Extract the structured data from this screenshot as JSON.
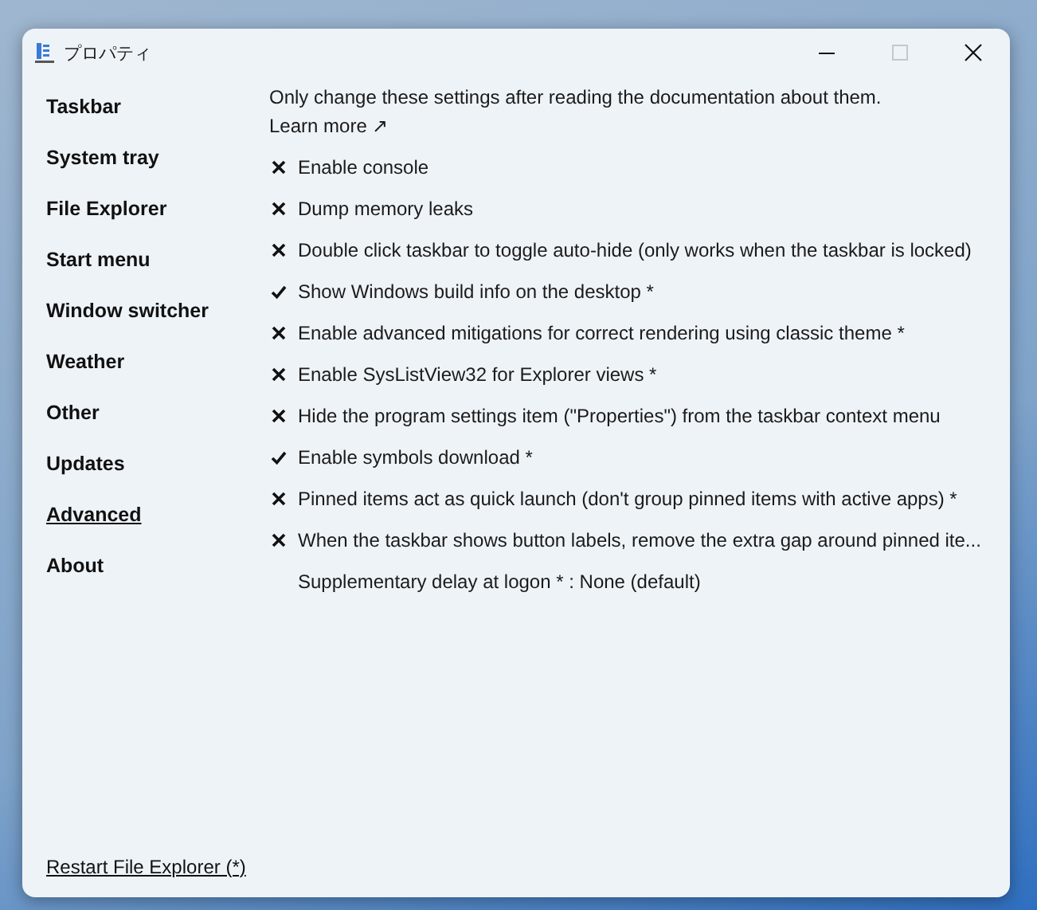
{
  "window": {
    "title": "プロパティ",
    "maximize_disabled": true
  },
  "sidebar": {
    "items": [
      {
        "label": "Taskbar",
        "selected": false
      },
      {
        "label": "System tray",
        "selected": false
      },
      {
        "label": "File Explorer",
        "selected": false
      },
      {
        "label": "Start menu",
        "selected": false
      },
      {
        "label": "Window switcher",
        "selected": false
      },
      {
        "label": "Weather",
        "selected": false
      },
      {
        "label": "Other",
        "selected": false
      },
      {
        "label": "Updates",
        "selected": false
      },
      {
        "label": "Advanced",
        "selected": true
      },
      {
        "label": "About",
        "selected": false
      }
    ],
    "footer_link": "Restart File Explorer (*)"
  },
  "content": {
    "intro": "Only change these settings after reading the documentation about them.",
    "learn_more": "Learn more ↗",
    "options": [
      {
        "kind": "toggle",
        "label": "Enable console",
        "checked": false
      },
      {
        "kind": "toggle",
        "label": "Dump memory leaks",
        "checked": false
      },
      {
        "kind": "toggle",
        "label": "Double click taskbar to toggle auto-hide (only works when the taskbar is locked)",
        "checked": false
      },
      {
        "kind": "toggle",
        "label": "Show Windows build info on the desktop *",
        "checked": true
      },
      {
        "kind": "toggle",
        "label": "Enable advanced mitigations for correct rendering using classic theme *",
        "checked": false
      },
      {
        "kind": "toggle",
        "label": "Enable SysListView32 for Explorer views *",
        "checked": false
      },
      {
        "kind": "toggle",
        "label": "Hide the program settings item (\"Properties\") from the taskbar context menu",
        "checked": false
      },
      {
        "kind": "toggle",
        "label": "Enable symbols download *",
        "checked": true
      },
      {
        "kind": "toggle",
        "label": "Pinned items act as quick launch (don't group pinned items with active apps) *",
        "checked": false
      },
      {
        "kind": "toggle",
        "label": "When the taskbar shows button labels, remove the extra gap around pinned ite...",
        "checked": false
      },
      {
        "kind": "choice",
        "label": "Supplementary delay at logon * : None (default)"
      }
    ]
  }
}
